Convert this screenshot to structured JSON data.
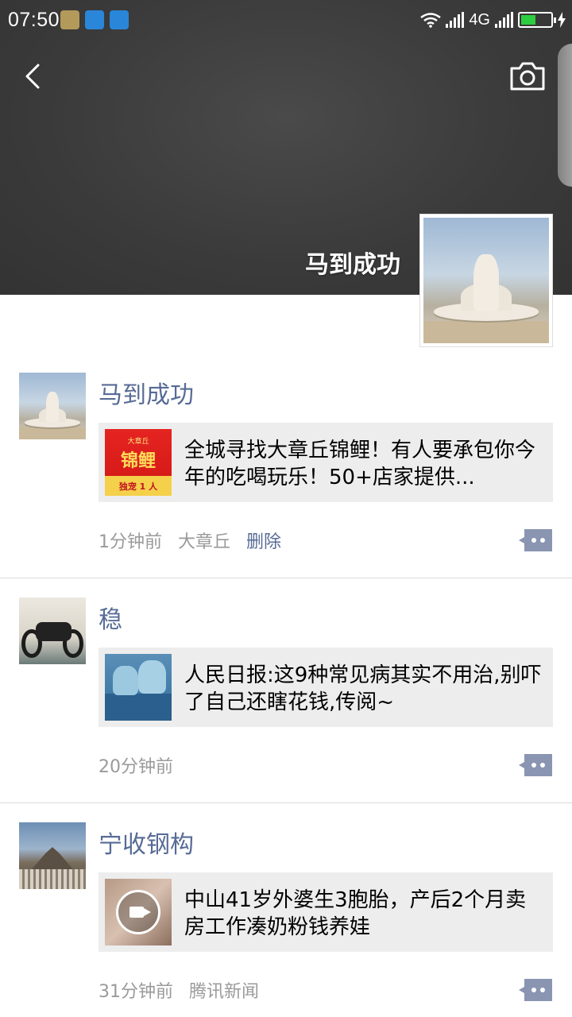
{
  "status_bar": {
    "time": "07:50",
    "network": "4G"
  },
  "profile": {
    "name": "马到成功"
  },
  "feed": [
    {
      "author": "马到成功",
      "share_title": "全城寻找大章丘锦鲤！有人要承包你今年的吃喝玩乐！50+店家提供...",
      "thumb_text_top": "大章丘",
      "thumb_text_big": "锦鲤",
      "thumb_text_badge": "独宠 1 人",
      "time": "1分钟前",
      "location": "大章丘",
      "delete_label": "删除"
    },
    {
      "author": "稳",
      "share_title": "人民日报:这9种常见病其实不用治,别吓了自己还瞎花钱,传阅~",
      "time": "20分钟前"
    },
    {
      "author": "宁收钢构",
      "share_title": "中山41岁外婆生3胞胎，产后2个月卖房工作凑奶粉钱养娃",
      "time": "31分钟前",
      "source": "腾讯新闻"
    }
  ],
  "icons": {
    "back": "back-arrow-icon",
    "camera": "camera-icon",
    "comment": "comment-icon",
    "video": "video-play-icon"
  },
  "colors": {
    "link": "#576b95",
    "meta": "#9a9a9a",
    "share_bg": "#ededed",
    "cover_bg": "#3a3a3a"
  }
}
